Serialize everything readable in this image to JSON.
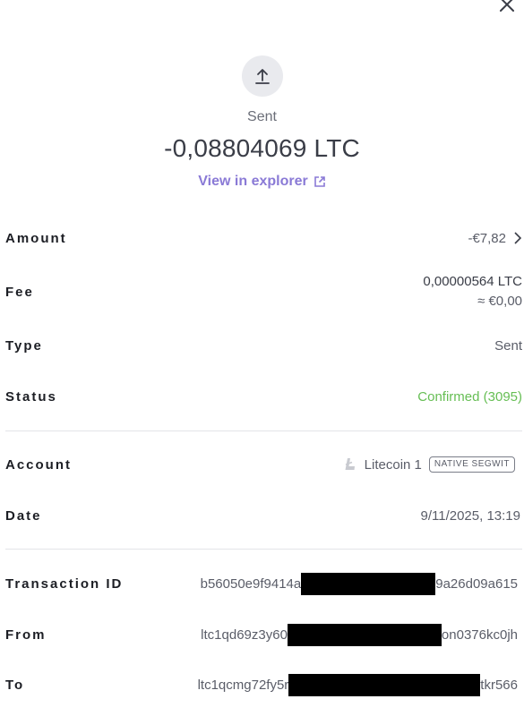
{
  "header": {
    "close_icon": "close-icon"
  },
  "operation": {
    "icon": "arrow-up-icon",
    "type_label": "Sent",
    "amount": "-0,08804069 LTC",
    "explorer_link": "View in explorer",
    "explorer_icon": "external-link-icon"
  },
  "details": {
    "amount": {
      "label": "Amount",
      "value": "-€7,82"
    },
    "fee": {
      "label": "Fee",
      "value": "0,00000564 LTC",
      "fiat": "≈ €0,00"
    },
    "type": {
      "label": "Type",
      "value": "Sent"
    },
    "status": {
      "label": "Status",
      "value": "Confirmed (3095)",
      "color": "#66be54"
    },
    "account": {
      "label": "Account",
      "value": "Litecoin 1",
      "badge": "NATIVE SEGWIT",
      "icon": "litecoin-icon"
    },
    "date": {
      "label": "Date",
      "value": "9/11/2025, 13:19"
    },
    "transaction_id": {
      "label": "Transaction ID",
      "prefix": "b56050e9f9414a",
      "suffix": "9a26d09a615"
    },
    "from": {
      "label": "From",
      "prefix": "ltc1qd69z3y60",
      "suffix": "on0376kc0jh"
    },
    "to": {
      "label": "To",
      "prefix": "ltc1qcmg72fy5r",
      "suffix": "tkr566"
    }
  }
}
